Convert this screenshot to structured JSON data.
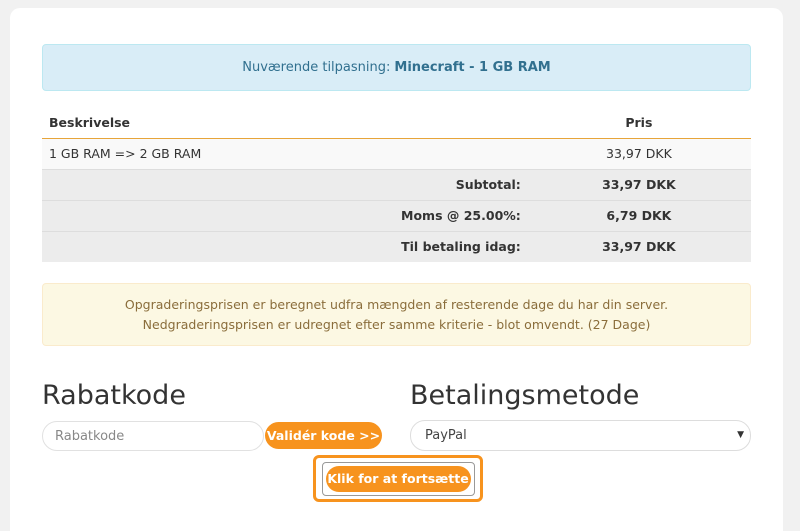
{
  "info": {
    "prefix": "Nuværende tilpasning:",
    "product": "Minecraft - 1 GB RAM"
  },
  "table": {
    "headers": {
      "description": "Beskrivelse",
      "price": "Pris"
    },
    "item": {
      "description": "1 GB RAM => 2 GB RAM",
      "price": "33,97 DKK"
    },
    "subtotal": {
      "label": "Subtotal:",
      "value": "33,97 DKK"
    },
    "vat": {
      "label": "Moms @ 25.00%:",
      "value": "6,79 DKK"
    },
    "total": {
      "label": "Til betaling idag:",
      "value": "33,97 DKK"
    }
  },
  "note": "Opgraderingsprisen er beregnet udfra mængden af resterende dage du har din server. Nedgraderingsprisen er udregnet efter samme kriterie - blot omvendt. (27 Dage)",
  "coupon": {
    "heading": "Rabatkode",
    "placeholder": "Rabatkode",
    "value": "",
    "button": "Validér kode >>"
  },
  "payment": {
    "heading": "Betalingsmetode",
    "selected": "PayPal"
  },
  "continue_label": "Klik for at fortsætte",
  "colors": {
    "accent": "#f7931e",
    "info_bg": "#d9edf7",
    "warning_bg": "#fcf8e3"
  },
  "icons": {
    "select_arrow": "chevron-down-icon"
  }
}
